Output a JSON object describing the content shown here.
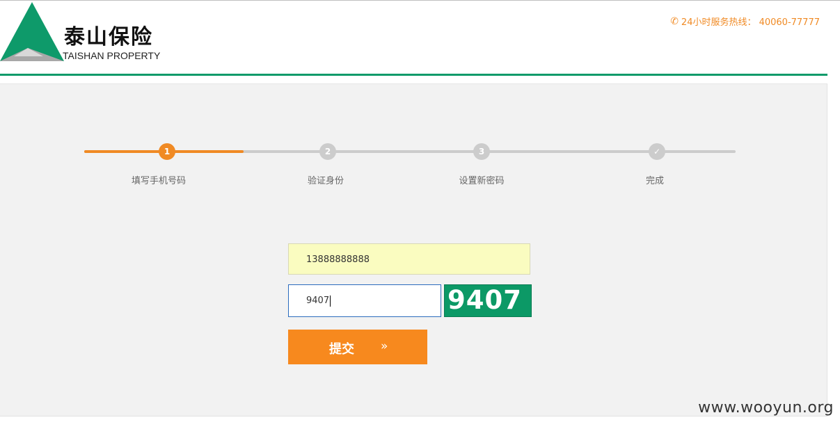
{
  "header": {
    "brand_cn": "泰山保险",
    "brand_en": "TAISHAN PROPERTY",
    "hotline_icon": "phone-icon",
    "hotline": "24小时服务热线： 40060-77777"
  },
  "steps": {
    "current": 1,
    "items": [
      {
        "number": "1",
        "label": "填写手机号码"
      },
      {
        "number": "2",
        "label": "验证身份"
      },
      {
        "number": "3",
        "label": "设置新密码"
      },
      {
        "number": "✓",
        "label": "完成"
      }
    ]
  },
  "form": {
    "phone_value": "13888888888",
    "captcha_value": "9407",
    "captcha_image_text": "9407",
    "submit_label": "提交",
    "submit_arrow": "»"
  },
  "watermark": "www.wooyun.org",
  "colors": {
    "brand_green": "#0e9a6a",
    "accent_orange": "#f7891e"
  }
}
